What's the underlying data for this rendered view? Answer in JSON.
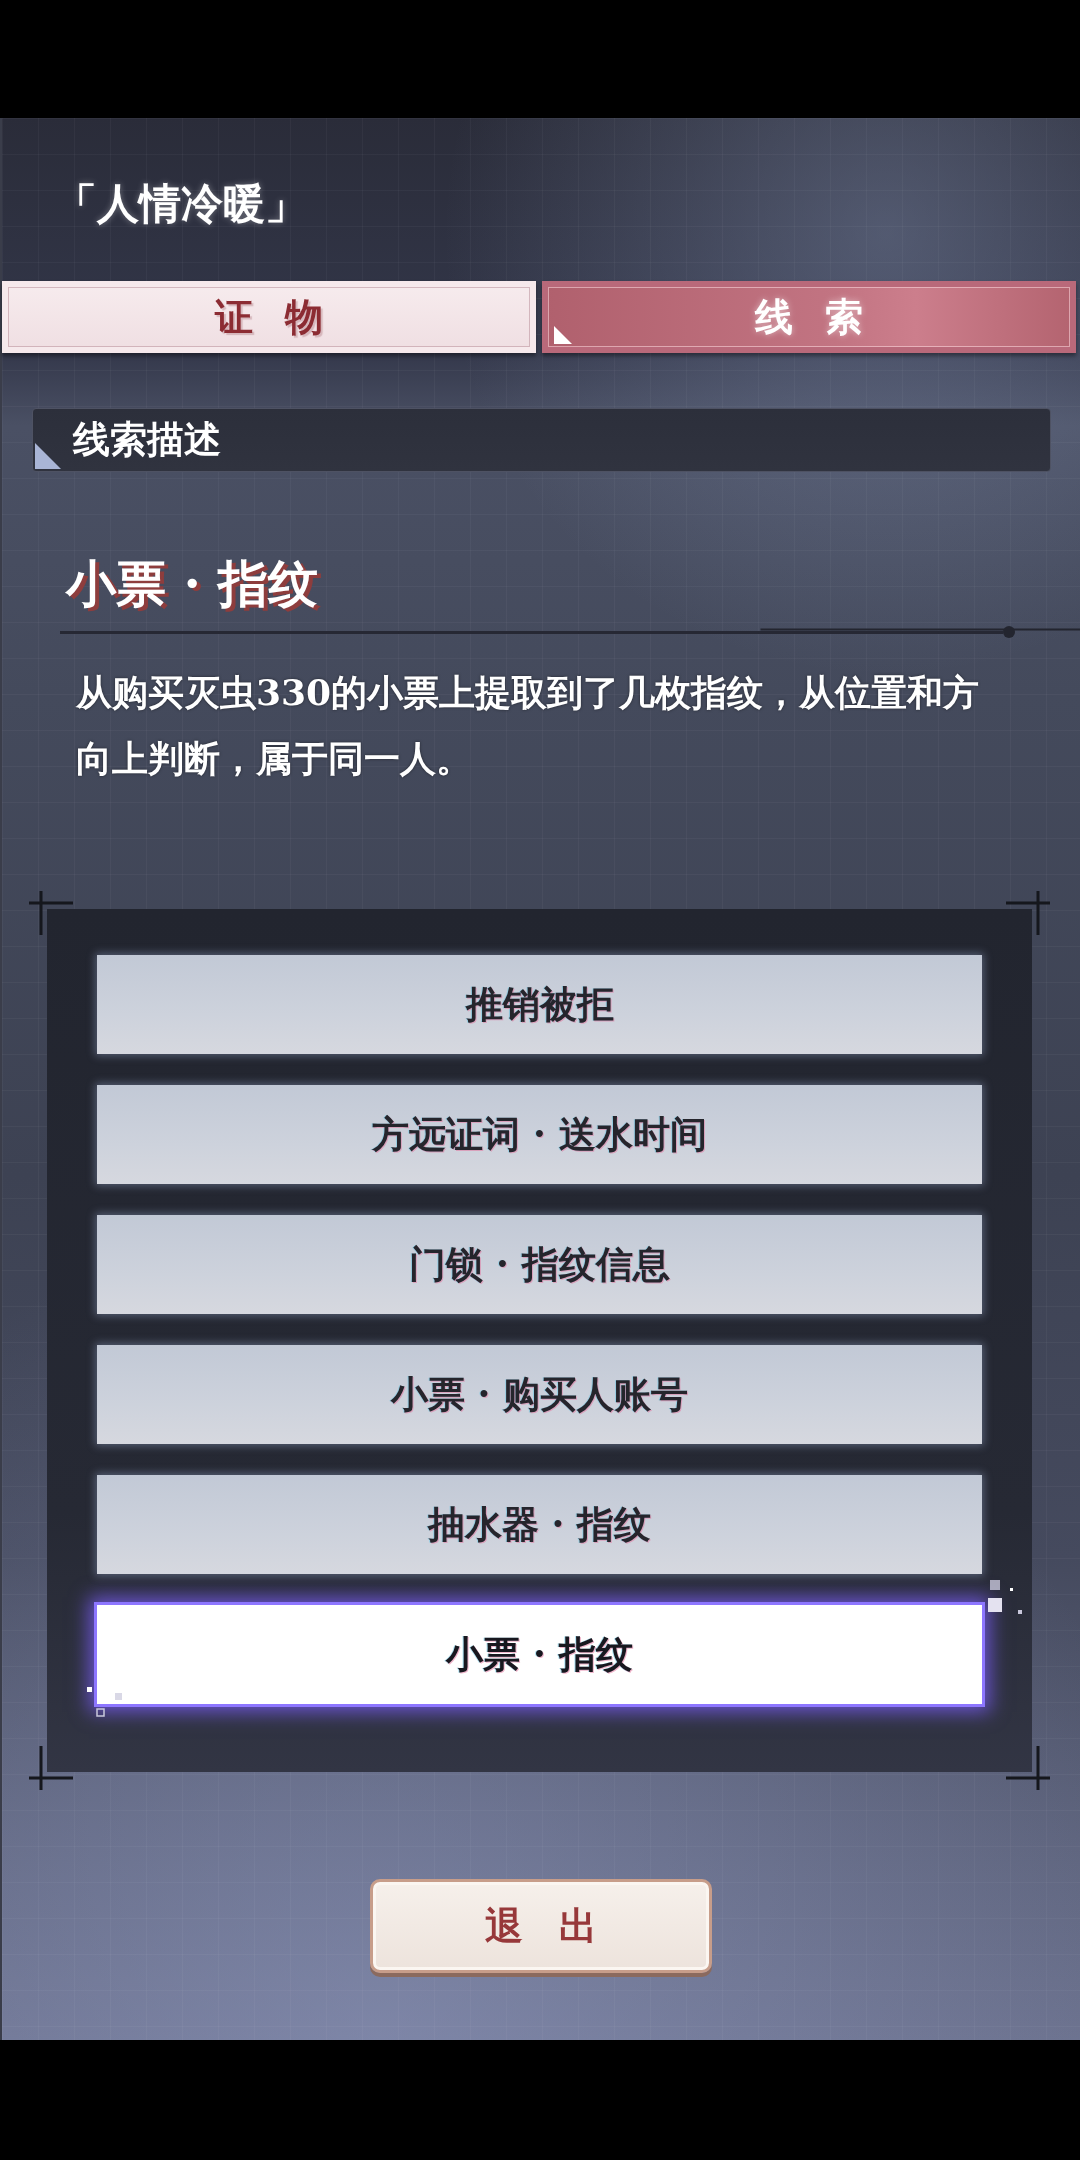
{
  "header": {
    "title": "「人情冷暖」"
  },
  "tabs": [
    {
      "label": "证 物",
      "selected": false
    },
    {
      "label": "线 索",
      "selected": true
    }
  ],
  "section": {
    "title": "线索描述"
  },
  "clue": {
    "title": "小票 · 指纹",
    "description": "从购买灭虫330的小票上提取到了几枚指纹，从位置和方向上判断，属于同一人。"
  },
  "clue_list": [
    {
      "label": "推销被拒",
      "selected": false
    },
    {
      "label": "方远证词 · 送水时间",
      "selected": false
    },
    {
      "label": "门锁 · 指纹信息",
      "selected": false
    },
    {
      "label": "小票 · 购买人账号",
      "selected": false
    },
    {
      "label": "抽水器 · 指纹",
      "selected": false
    },
    {
      "label": "小票 · 指纹",
      "selected": true
    }
  ],
  "exit_button": {
    "label": "退 出"
  }
}
